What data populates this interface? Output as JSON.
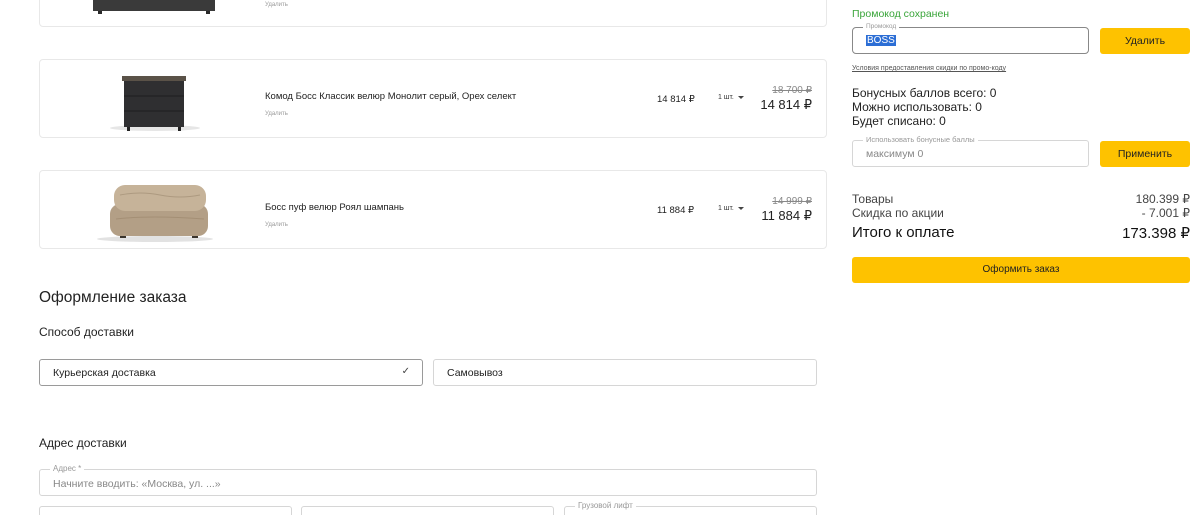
{
  "cart": {
    "top_item": {
      "delete": "Удалить"
    },
    "items": [
      {
        "name": "Комод Босс Классик велюр Монолит серый, Орех селект",
        "delete": "Удалить",
        "price": "14 814 ₽",
        "qty": "1 шт.",
        "old_price": "18 700 ₽",
        "new_price": "14 814 ₽"
      },
      {
        "name": "Босс пуф велюр Роял шампань",
        "delete": "Удалить",
        "price": "11 884 ₽",
        "qty": "1 шт.",
        "old_price": "14 999 ₽",
        "new_price": "11 884 ₽"
      }
    ]
  },
  "checkout": {
    "title": "Оформление заказа",
    "delivery": {
      "title": "Способ доставки",
      "options": [
        "Курьерская доставка",
        "Самовывоз"
      ],
      "selected": "Курьерская доставка"
    },
    "address": {
      "title": "Адрес доставки",
      "label": "Адрес *",
      "placeholder": "Начните вводить: «Москва, ул. ...»",
      "freight_label": "Грузовой лифт"
    }
  },
  "summary": {
    "promo_status": "Промокод сохранен",
    "promo_label": "Промокод",
    "promo_value": "BOSS",
    "promo_delete": "Удалить",
    "promo_conditions": "Условия предоставления скидки по промо-коду",
    "bonus_total": "Бонусных баллов всего: 0",
    "bonus_usable": "Можно использовать: 0",
    "bonus_spent": "Будет списано: 0",
    "bonus_label": "Использовать бонусные баллы",
    "bonus_placeholder": "максимум 0",
    "bonus_apply": "Применить",
    "goods_label": "Товары",
    "goods_value": "180.399 ₽",
    "discount_label": "Скидка по акции",
    "discount_value": "- 7.001 ₽",
    "total_label": "Итого к оплате",
    "total_value": "173.398 ₽",
    "order_button": "Оформить заказ"
  },
  "colors": {
    "accent": "#fec200",
    "success": "#3aa53a",
    "selection": "#2c6ed5"
  }
}
